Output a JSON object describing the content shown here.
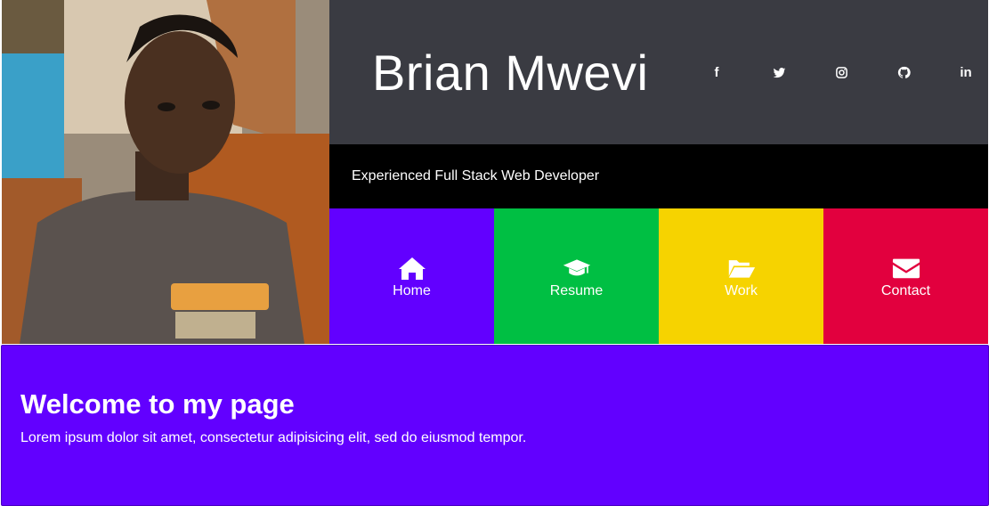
{
  "profile": {
    "name": "Brian Mwevi",
    "tagline": "Experienced Full Stack Web Developer",
    "photo_alt": "Portrait photo"
  },
  "socials": [
    {
      "name": "facebook",
      "glyph": "f"
    },
    {
      "name": "twitter"
    },
    {
      "name": "instagram"
    },
    {
      "name": "github"
    },
    {
      "name": "linkedin",
      "glyph": "in"
    }
  ],
  "nav": [
    {
      "label": "Home",
      "icon": "home-icon",
      "color": "#6200ff"
    },
    {
      "label": "Resume",
      "icon": "graduation-cap-icon",
      "color": "#00bf43"
    },
    {
      "label": "Work",
      "icon": "folder-open-icon",
      "color": "#f6d300"
    },
    {
      "label": "Contact",
      "icon": "envelope-icon",
      "color": "#e2003e"
    }
  ],
  "welcome": {
    "heading": "Welcome to my page",
    "text": "Lorem ipsum dolor sit amet, consectetur adipisicing elit, sed do eiusmod tempor."
  },
  "colors": {
    "header_bg": "#3a3b42",
    "tagline_bg": "#000000",
    "welcome_bg": "#6200ff"
  }
}
